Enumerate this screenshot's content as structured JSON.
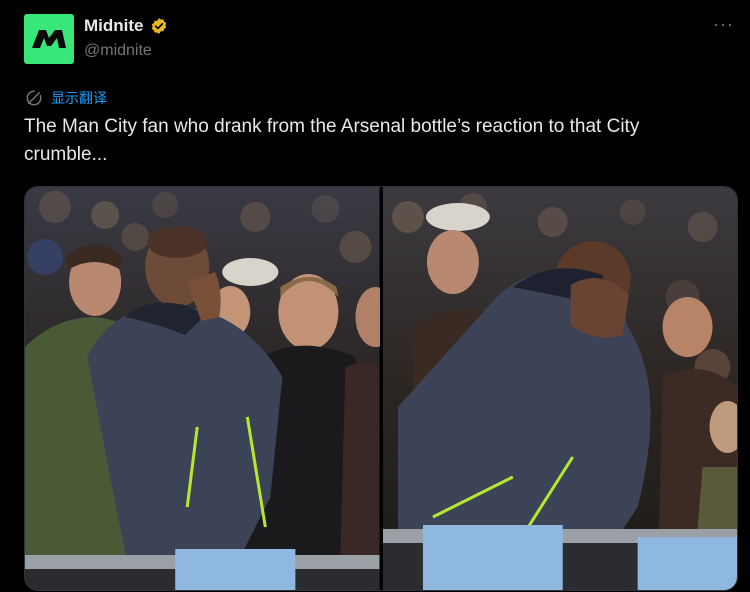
{
  "author": {
    "display_name": "Midnite",
    "handle": "@midnite",
    "avatar_letter": "M",
    "verified": true,
    "avatar_color": "#39e67a",
    "verified_color": "#e8b923"
  },
  "menu": {
    "more_label": "···"
  },
  "translate": {
    "label": "显示翻译",
    "icon": "translate-icon"
  },
  "tweet": {
    "text": "The Man City fan who drank from the Arsenal bottle’s reaction to that City crumble..."
  },
  "media": {
    "photos": [
      {
        "icon": "photo-fan-praying"
      },
      {
        "icon": "photo-fan-face-in-hands"
      }
    ]
  },
  "colors": {
    "background": "#000000",
    "text": "#e7e9ea",
    "secondary_text": "#71767b",
    "link": "#1d9bf0"
  }
}
